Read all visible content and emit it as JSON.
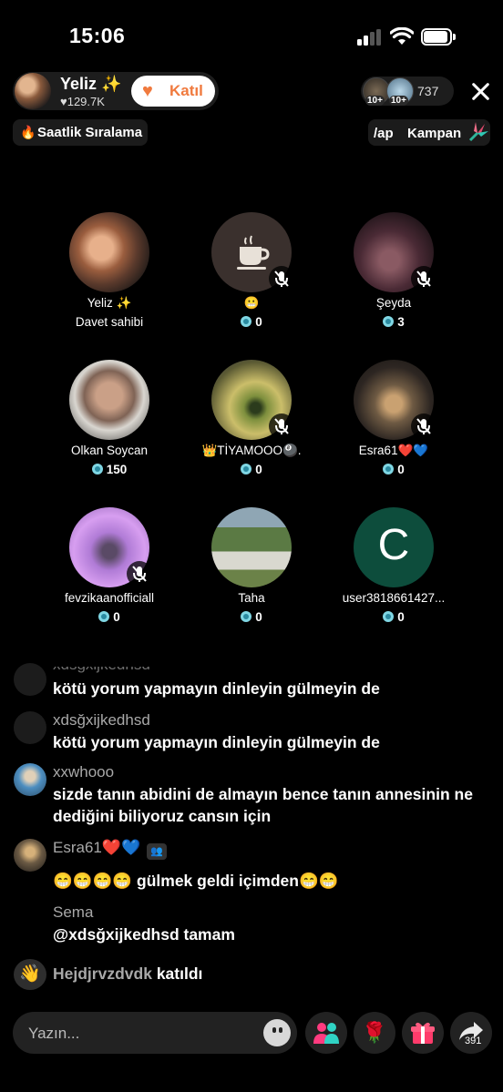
{
  "status_bar": {
    "time": "15:06"
  },
  "host": {
    "name": "Yeliz ✨",
    "likes": "♥129.7K",
    "join_label": "Katıl"
  },
  "viewers": {
    "badges": [
      "10+",
      "10+"
    ],
    "count": "737"
  },
  "ranking": {
    "label": "Saatlik Sıralama"
  },
  "campaign": {
    "label_partial": "/ap",
    "label": "Kampan"
  },
  "guests": [
    {
      "name": "Yeliz ✨",
      "sub": "Davet sahibi",
      "muted": false,
      "avatar": "photo-couple"
    },
    {
      "name": "😬",
      "sub": "0",
      "muted": true,
      "avatar": "coffee-icon"
    },
    {
      "name": "Şeyda",
      "sub": "3",
      "muted": true,
      "avatar": "photo-dark"
    },
    {
      "name": "Olkan Soycan",
      "sub": "150",
      "muted": false,
      "avatar": "photo-man"
    },
    {
      "name": "👑TİYAMOOO🎱.",
      "sub": "0",
      "muted": true,
      "avatar": "photo-eye"
    },
    {
      "name": "Esra61❤️💙",
      "sub": "0",
      "muted": true,
      "avatar": "photo-tower"
    },
    {
      "name": "fevzikaanofficiall",
      "sub": "0",
      "muted": true,
      "avatar": "photo-purple"
    },
    {
      "name": "Taha",
      "sub": "0",
      "muted": false,
      "avatar": "photo-outdoor"
    },
    {
      "name": "user3818661427...",
      "sub": "0",
      "muted": false,
      "avatar": "letter-c"
    }
  ],
  "avatar_letter": "C",
  "chat": [
    {
      "user": "xdsğxijkedhsd",
      "text": "kötü yorum yapmayın dinleyin gülmeyin de"
    },
    {
      "user": "xdsğxijkedhsd",
      "text": "kötü yorum yapmayın dinleyin gülmeyin de"
    },
    {
      "user": "xxwhooo",
      "text": "sizde tanın abidini de almayın bence tanın annesinin ne dediğini biliyoruz cansın için"
    },
    {
      "user": "Esra61❤️💙",
      "text": "😁😁😁😁 gülmek geldi içimden😁😁"
    },
    {
      "user": "Sema",
      "text": "@xdsğxijkedhsd tamam"
    }
  ],
  "join_event": {
    "user": "Hejdjrvzdvdk",
    "action": "katıldı"
  },
  "bottom_bar": {
    "input_placeholder": "Yazın...",
    "share_count": "391"
  },
  "colors": {
    "accent": "#f07a3e",
    "coin": "#7fd6e3",
    "background": "#000000"
  }
}
